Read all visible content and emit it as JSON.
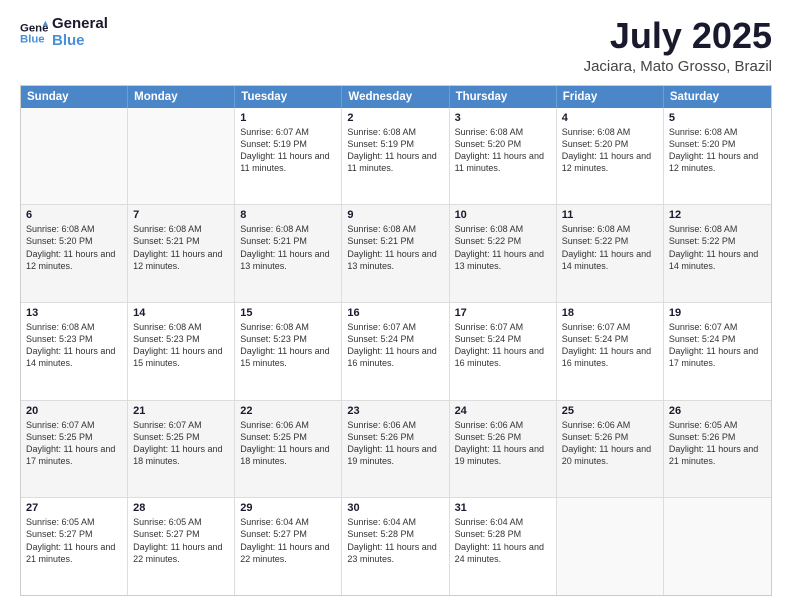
{
  "logo": {
    "line1": "General",
    "line2": "Blue"
  },
  "title": "July 2025",
  "subtitle": "Jaciara, Mato Grosso, Brazil",
  "days": [
    "Sunday",
    "Monday",
    "Tuesday",
    "Wednesday",
    "Thursday",
    "Friday",
    "Saturday"
  ],
  "weeks": [
    [
      {
        "day": "",
        "text": ""
      },
      {
        "day": "",
        "text": ""
      },
      {
        "day": "1",
        "text": "Sunrise: 6:07 AM\nSunset: 5:19 PM\nDaylight: 11 hours and 11 minutes."
      },
      {
        "day": "2",
        "text": "Sunrise: 6:08 AM\nSunset: 5:19 PM\nDaylight: 11 hours and 11 minutes."
      },
      {
        "day": "3",
        "text": "Sunrise: 6:08 AM\nSunset: 5:20 PM\nDaylight: 11 hours and 11 minutes."
      },
      {
        "day": "4",
        "text": "Sunrise: 6:08 AM\nSunset: 5:20 PM\nDaylight: 11 hours and 12 minutes."
      },
      {
        "day": "5",
        "text": "Sunrise: 6:08 AM\nSunset: 5:20 PM\nDaylight: 11 hours and 12 minutes."
      }
    ],
    [
      {
        "day": "6",
        "text": "Sunrise: 6:08 AM\nSunset: 5:20 PM\nDaylight: 11 hours and 12 minutes."
      },
      {
        "day": "7",
        "text": "Sunrise: 6:08 AM\nSunset: 5:21 PM\nDaylight: 11 hours and 12 minutes."
      },
      {
        "day": "8",
        "text": "Sunrise: 6:08 AM\nSunset: 5:21 PM\nDaylight: 11 hours and 13 minutes."
      },
      {
        "day": "9",
        "text": "Sunrise: 6:08 AM\nSunset: 5:21 PM\nDaylight: 11 hours and 13 minutes."
      },
      {
        "day": "10",
        "text": "Sunrise: 6:08 AM\nSunset: 5:22 PM\nDaylight: 11 hours and 13 minutes."
      },
      {
        "day": "11",
        "text": "Sunrise: 6:08 AM\nSunset: 5:22 PM\nDaylight: 11 hours and 14 minutes."
      },
      {
        "day": "12",
        "text": "Sunrise: 6:08 AM\nSunset: 5:22 PM\nDaylight: 11 hours and 14 minutes."
      }
    ],
    [
      {
        "day": "13",
        "text": "Sunrise: 6:08 AM\nSunset: 5:23 PM\nDaylight: 11 hours and 14 minutes."
      },
      {
        "day": "14",
        "text": "Sunrise: 6:08 AM\nSunset: 5:23 PM\nDaylight: 11 hours and 15 minutes."
      },
      {
        "day": "15",
        "text": "Sunrise: 6:08 AM\nSunset: 5:23 PM\nDaylight: 11 hours and 15 minutes."
      },
      {
        "day": "16",
        "text": "Sunrise: 6:07 AM\nSunset: 5:24 PM\nDaylight: 11 hours and 16 minutes."
      },
      {
        "day": "17",
        "text": "Sunrise: 6:07 AM\nSunset: 5:24 PM\nDaylight: 11 hours and 16 minutes."
      },
      {
        "day": "18",
        "text": "Sunrise: 6:07 AM\nSunset: 5:24 PM\nDaylight: 11 hours and 16 minutes."
      },
      {
        "day": "19",
        "text": "Sunrise: 6:07 AM\nSunset: 5:24 PM\nDaylight: 11 hours and 17 minutes."
      }
    ],
    [
      {
        "day": "20",
        "text": "Sunrise: 6:07 AM\nSunset: 5:25 PM\nDaylight: 11 hours and 17 minutes."
      },
      {
        "day": "21",
        "text": "Sunrise: 6:07 AM\nSunset: 5:25 PM\nDaylight: 11 hours and 18 minutes."
      },
      {
        "day": "22",
        "text": "Sunrise: 6:06 AM\nSunset: 5:25 PM\nDaylight: 11 hours and 18 minutes."
      },
      {
        "day": "23",
        "text": "Sunrise: 6:06 AM\nSunset: 5:26 PM\nDaylight: 11 hours and 19 minutes."
      },
      {
        "day": "24",
        "text": "Sunrise: 6:06 AM\nSunset: 5:26 PM\nDaylight: 11 hours and 19 minutes."
      },
      {
        "day": "25",
        "text": "Sunrise: 6:06 AM\nSunset: 5:26 PM\nDaylight: 11 hours and 20 minutes."
      },
      {
        "day": "26",
        "text": "Sunrise: 6:05 AM\nSunset: 5:26 PM\nDaylight: 11 hours and 21 minutes."
      }
    ],
    [
      {
        "day": "27",
        "text": "Sunrise: 6:05 AM\nSunset: 5:27 PM\nDaylight: 11 hours and 21 minutes."
      },
      {
        "day": "28",
        "text": "Sunrise: 6:05 AM\nSunset: 5:27 PM\nDaylight: 11 hours and 22 minutes."
      },
      {
        "day": "29",
        "text": "Sunrise: 6:04 AM\nSunset: 5:27 PM\nDaylight: 11 hours and 22 minutes."
      },
      {
        "day": "30",
        "text": "Sunrise: 6:04 AM\nSunset: 5:28 PM\nDaylight: 11 hours and 23 minutes."
      },
      {
        "day": "31",
        "text": "Sunrise: 6:04 AM\nSunset: 5:28 PM\nDaylight: 11 hours and 24 minutes."
      },
      {
        "day": "",
        "text": ""
      },
      {
        "day": "",
        "text": ""
      }
    ]
  ]
}
